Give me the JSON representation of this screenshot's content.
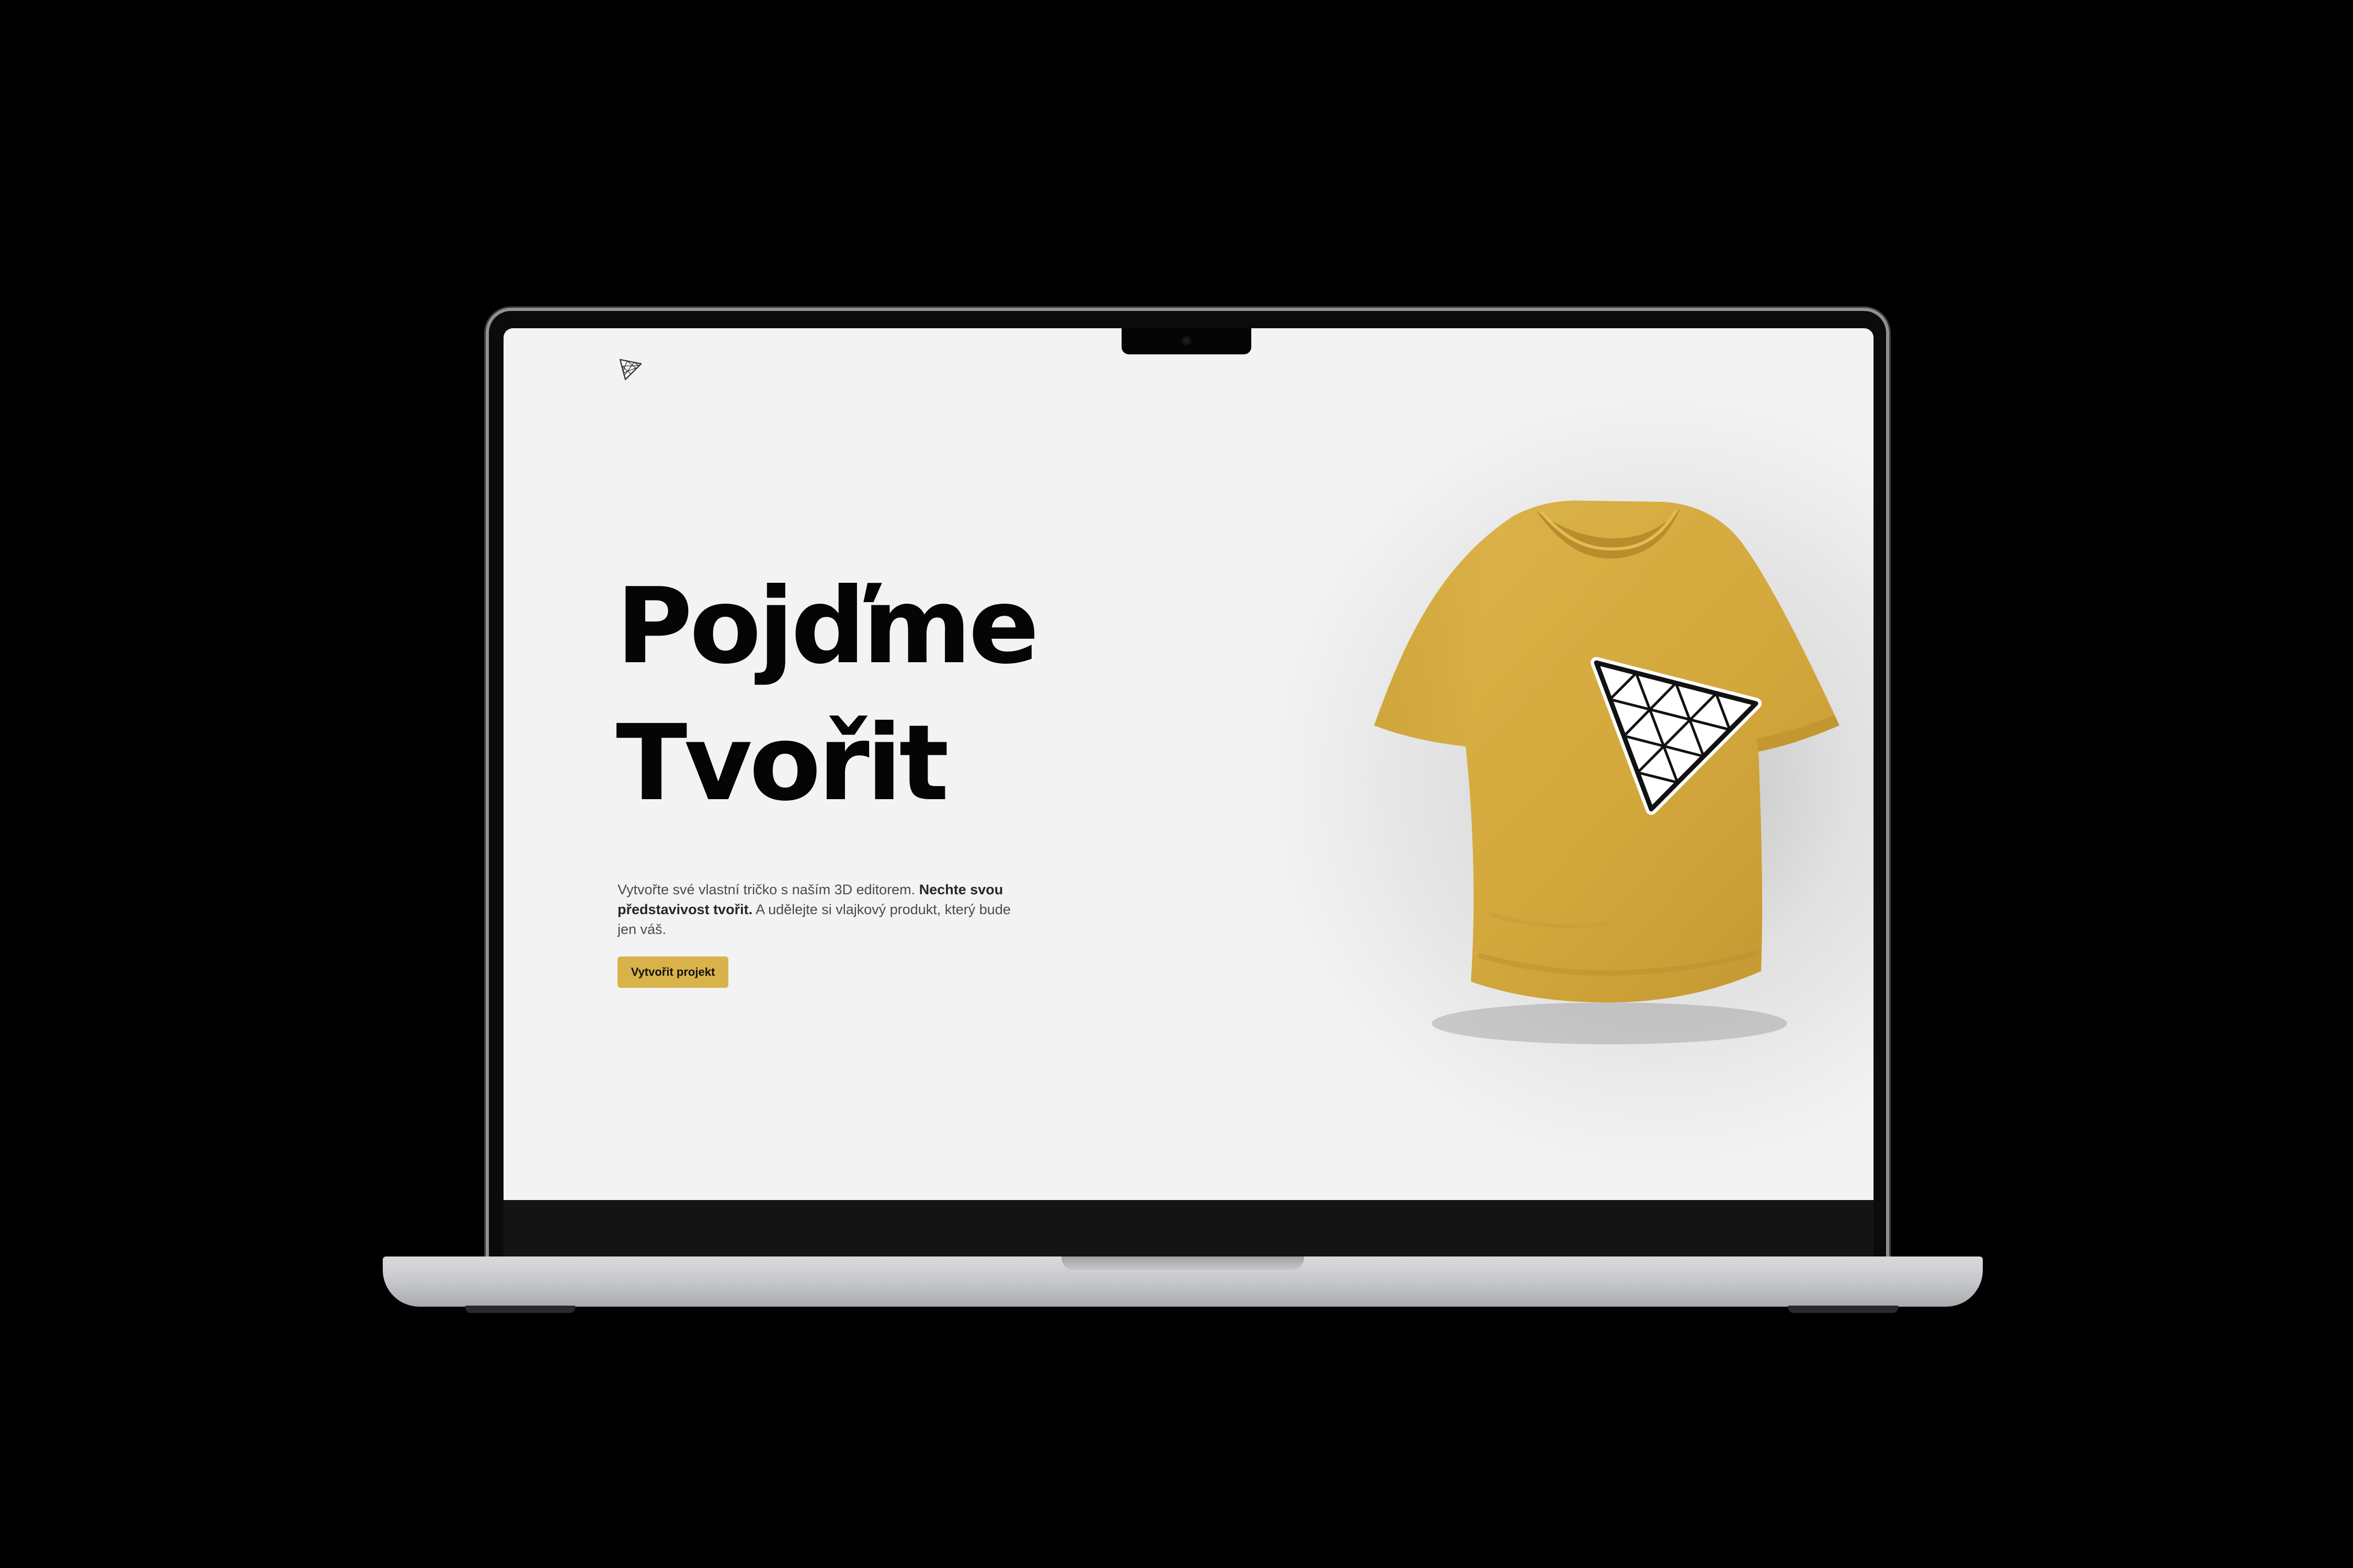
{
  "hero": {
    "title_line1": "Pojďme",
    "title_line2": "Tvořit",
    "description_part1": "Vytvořte své vlastní tričko s naším 3D editorem. ",
    "description_bold": "Nechte svou představivost tvořit.",
    "description_part2": " A udělejte si vlajkový produkt, který bude jen váš.",
    "cta_label": "Vytvořit projekt"
  },
  "icons": {
    "logo": "triangle-grid-logo-icon",
    "product": "tshirt-with-triangle-logo"
  },
  "colors": {
    "accent": "#d9b24a",
    "shirt": "#d4aa3f",
    "page_background": "#f3f3f3",
    "text": "#050505"
  }
}
